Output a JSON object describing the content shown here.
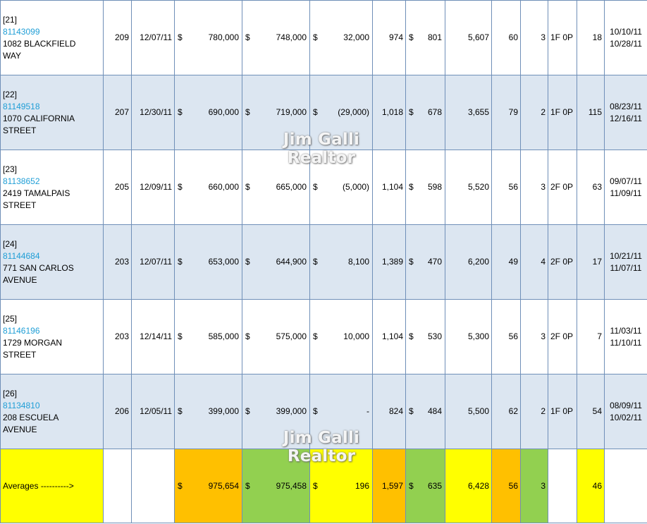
{
  "watermark": "Jim Galli Realtor",
  "colors": {
    "row_alt": "#dce6f1",
    "border": "#6f8fb8",
    "mls_link": "#1f9ed6",
    "orange": "#ffc000",
    "green": "#92d050",
    "yellow": "#ffff00"
  },
  "rows": [
    {
      "index": "[21]",
      "mls": "81143099",
      "addr1": "1082 BLACKFIELD",
      "addr2": "WAY",
      "c1": "209",
      "date": "12/07/11",
      "p1": "780,000",
      "p2": "748,000",
      "diff": "32,000",
      "sqft": "974",
      "ppsf": "801",
      "lot": "5,607",
      "age": "60",
      "beds": "3",
      "baths": "1F 0P",
      "dom": "18",
      "d1": "10/10/11",
      "d2": "10/28/11"
    },
    {
      "index": "[22]",
      "mls": "81149518",
      "addr1": "1070 CALIFORNIA",
      "addr2": "STREET",
      "c1": "207",
      "date": "12/30/11",
      "p1": "690,000",
      "p2": "719,000",
      "diff": "(29,000)",
      "sqft": "1,018",
      "ppsf": "678",
      "lot": "3,655",
      "age": "79",
      "beds": "2",
      "baths": "1F 0P",
      "dom": "115",
      "d1": "08/23/11",
      "d2": "12/16/11"
    },
    {
      "index": "[23]",
      "mls": "81138652",
      "addr1": "2419 TAMALPAIS",
      "addr2": "STREET",
      "c1": "205",
      "date": "12/09/11",
      "p1": "660,000",
      "p2": "665,000",
      "diff": "(5,000)",
      "sqft": "1,104",
      "ppsf": "598",
      "lot": "5,520",
      "age": "56",
      "beds": "3",
      "baths": "2F 0P",
      "dom": "63",
      "d1": "09/07/11",
      "d2": "11/09/11"
    },
    {
      "index": "[24]",
      "mls": "81144684",
      "addr1": "771 SAN CARLOS",
      "addr2": "AVENUE",
      "c1": "203",
      "date": "12/07/11",
      "p1": "653,000",
      "p2": "644,900",
      "diff": "8,100",
      "sqft": "1,389",
      "ppsf": "470",
      "lot": "6,200",
      "age": "49",
      "beds": "4",
      "baths": "2F 0P",
      "dom": "17",
      "d1": "10/21/11",
      "d2": "11/07/11"
    },
    {
      "index": "[25]",
      "mls": "81146196",
      "addr1": "1729 MORGAN",
      "addr2": "STREET",
      "c1": "203",
      "date": "12/14/11",
      "p1": "585,000",
      "p2": "575,000",
      "diff": "10,000",
      "sqft": "1,104",
      "ppsf": "530",
      "lot": "5,300",
      "age": "56",
      "beds": "3",
      "baths": "2F 0P",
      "dom": "7",
      "d1": "11/03/11",
      "d2": "11/10/11"
    },
    {
      "index": "[26]",
      "mls": "81134810",
      "addr1": "208 ESCUELA",
      "addr2": "AVENUE",
      "c1": "206",
      "date": "12/05/11",
      "p1": "399,000",
      "p2": "399,000",
      "diff": "-",
      "sqft": "824",
      "ppsf": "484",
      "lot": "5,500",
      "age": "62",
      "beds": "2",
      "baths": "1F 0P",
      "dom": "54",
      "d1": "08/09/11",
      "d2": "10/02/11"
    }
  ],
  "averages": {
    "label": "Averages ---------->",
    "currency": "$",
    "p1": "975,654",
    "p2": "975,458",
    "diff": "196",
    "sqft": "1,597",
    "ppsf": "635",
    "lot": "6,428",
    "age": "56",
    "beds": "3",
    "dom": "46"
  }
}
